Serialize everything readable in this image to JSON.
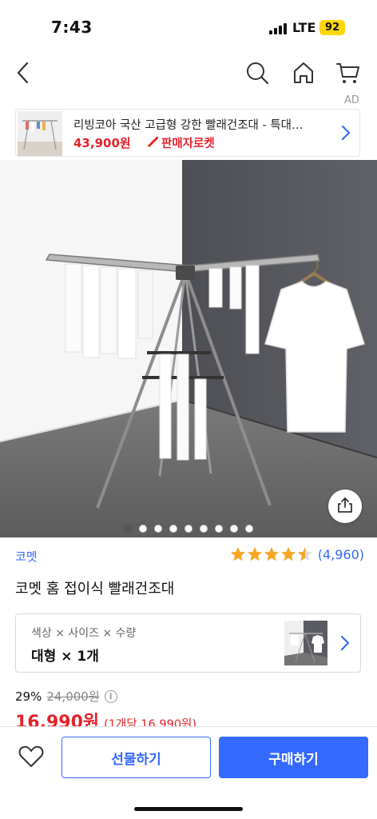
{
  "status_bar": {
    "time": "7:43",
    "network": "LTE",
    "battery": "92"
  },
  "nav": {
    "icons": [
      "back-icon",
      "search-icon",
      "home-icon",
      "cart-icon"
    ]
  },
  "ad": {
    "label": "AD",
    "title": "리빙코아 국산 고급형 강한 빨래건조대 - 특대…",
    "price": "43,900원",
    "badge": "판매자로켓"
  },
  "gallery": {
    "total_images": 9,
    "active_index": 0
  },
  "product": {
    "brand": "코멧",
    "rating": 4.5,
    "review_count": "(4,960)",
    "title": "코멧 홈 접이식 빨래건조대"
  },
  "option": {
    "labels": "색상 × 사이즈 × 수량",
    "value": "대형 × 1개"
  },
  "pricing": {
    "discount_rate": "29%",
    "original_price": "24,000원",
    "info_icon": "i",
    "sale_price": "16,990원",
    "unit_price": "(1개당 16,990원)"
  },
  "bottom": {
    "gift_label": "선물하기",
    "buy_label": "구매하기"
  },
  "colors": {
    "accent": "#346aff",
    "price_red": "#e4222b",
    "star": "#f5a623"
  }
}
